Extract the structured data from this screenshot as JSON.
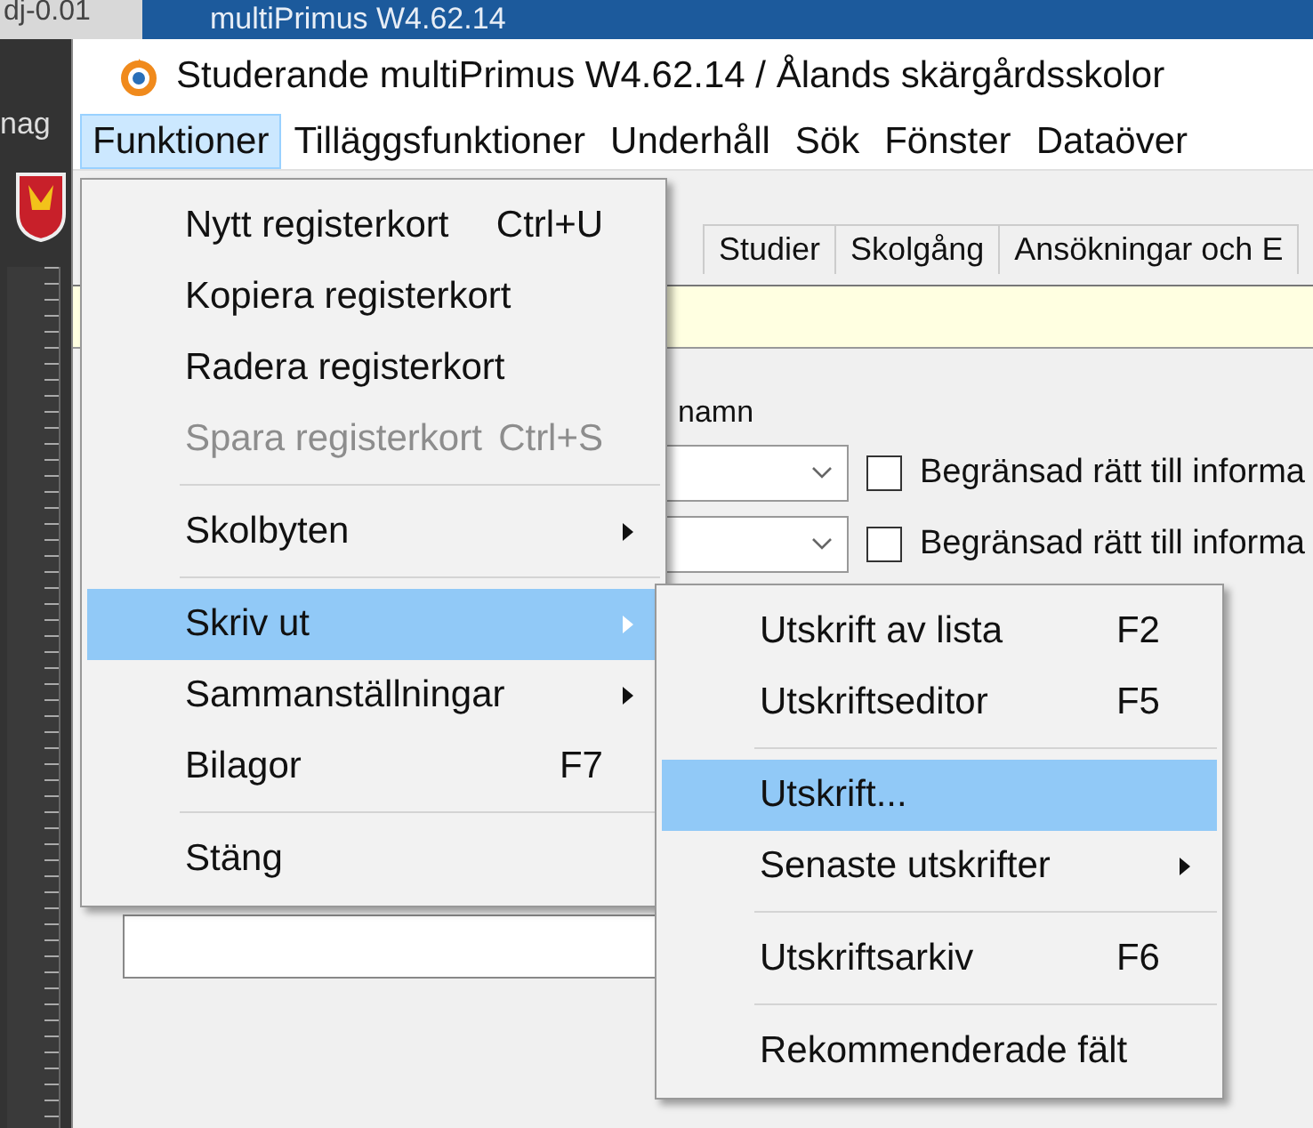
{
  "background": {
    "left_caption": "dj-0.01",
    "window_title": "multiPrimus W4.62.14",
    "side_label": "nag"
  },
  "window": {
    "title": "Studerande multiPrimus W4.62.14 / Ålands skärgårdsskolor"
  },
  "menubar": [
    {
      "label": "Funktioner",
      "selected": true
    },
    {
      "label": "Tilläggsfunktioner",
      "selected": false
    },
    {
      "label": "Underhåll",
      "selected": false
    },
    {
      "label": "Sök",
      "selected": false
    },
    {
      "label": "Fönster",
      "selected": false
    },
    {
      "label": "Dataöver",
      "selected": false
    }
  ],
  "tabs": [
    {
      "label": "Studier",
      "selected": false
    },
    {
      "label": "Skolgång",
      "selected": false
    },
    {
      "label": "Ansökningar och E",
      "selected": false
    }
  ],
  "form": {
    "label": "namn",
    "rows": [
      {
        "checkbox_label": "Begränsad rätt till informa",
        "checked": false
      },
      {
        "checkbox_label": "Begränsad rätt till informa",
        "checked": false
      }
    ]
  },
  "menu": {
    "items": [
      {
        "kind": "item",
        "label": "Nytt registerkort",
        "shortcut": "Ctrl+U",
        "disabled": false,
        "selected": false,
        "submenu": false
      },
      {
        "kind": "item",
        "label": "Kopiera registerkort",
        "disabled": false,
        "selected": false,
        "submenu": false
      },
      {
        "kind": "item",
        "label": "Radera registerkort",
        "disabled": false,
        "selected": false,
        "submenu": false
      },
      {
        "kind": "item",
        "label": "Spara registerkort",
        "shortcut": "Ctrl+S",
        "disabled": true,
        "selected": false,
        "submenu": false
      },
      {
        "kind": "separator"
      },
      {
        "kind": "item",
        "label": "Skolbyten",
        "disabled": false,
        "selected": false,
        "submenu": true
      },
      {
        "kind": "separator"
      },
      {
        "kind": "item",
        "label": "Skriv ut",
        "disabled": false,
        "selected": true,
        "submenu": true
      },
      {
        "kind": "item",
        "label": "Sammanställningar",
        "disabled": false,
        "selected": false,
        "submenu": true
      },
      {
        "kind": "item",
        "label": "Bilagor",
        "shortcut": "F7",
        "disabled": false,
        "selected": false,
        "submenu": false
      },
      {
        "kind": "separator"
      },
      {
        "kind": "item",
        "label": "Stäng",
        "disabled": false,
        "selected": false,
        "submenu": false
      }
    ]
  },
  "submenu": {
    "items": [
      {
        "kind": "item",
        "label": "Utskrift av lista",
        "shortcut": "F2",
        "disabled": false,
        "selected": false,
        "submenu": false
      },
      {
        "kind": "item",
        "label": "Utskriftseditor",
        "shortcut": "F5",
        "disabled": false,
        "selected": false,
        "submenu": false
      },
      {
        "kind": "separator"
      },
      {
        "kind": "item",
        "label": "Utskrift...",
        "disabled": false,
        "selected": true,
        "submenu": false
      },
      {
        "kind": "item",
        "label": "Senaste utskrifter",
        "disabled": false,
        "selected": false,
        "submenu": true
      },
      {
        "kind": "separator"
      },
      {
        "kind": "item",
        "label": "Utskriftsarkiv",
        "shortcut": "F6",
        "disabled": false,
        "selected": false,
        "submenu": false
      },
      {
        "kind": "separator"
      },
      {
        "kind": "item",
        "label": "Rekommenderade fält",
        "disabled": false,
        "selected": false,
        "submenu": false
      }
    ]
  }
}
